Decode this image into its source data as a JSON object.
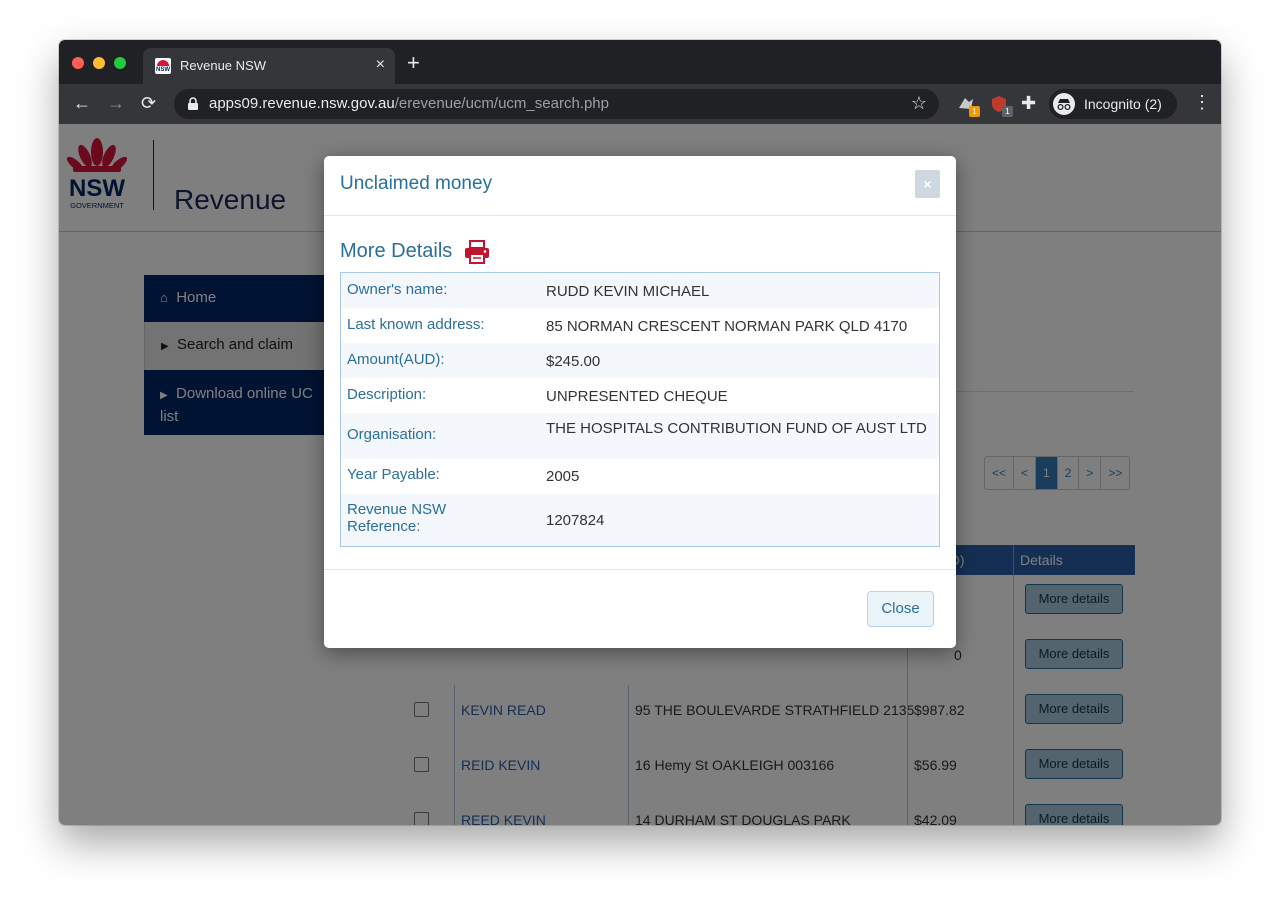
{
  "browser": {
    "tab_title": "Revenue NSW",
    "tab_favicon_text": "NSW",
    "url_host": "apps09.revenue.nsw.gov.au",
    "url_path": "/erevenue/ucm/ucm_search.php",
    "incognito_label": "Incognito (2)",
    "extension_badges": [
      "1",
      "1"
    ]
  },
  "header": {
    "logo_text": "NSW",
    "logo_subtext": "GOVERNMENT",
    "site_title": "Revenue"
  },
  "sidenav": {
    "items": [
      {
        "label": "Home",
        "icon": "home-icon"
      },
      {
        "label": "Search and claim",
        "icon": "caret-right-icon"
      },
      {
        "label": "Download online UC list",
        "icon": "caret-right-icon"
      }
    ]
  },
  "pagination": {
    "items": [
      "<<",
      "<",
      "1",
      "2",
      ">",
      ">>"
    ],
    "active": "1"
  },
  "results": {
    "headers": [
      "",
      "",
      "",
      "nt(AUD)",
      "Details"
    ],
    "button_label": "More details",
    "partial_amount": "0",
    "rows": [
      {
        "name": "KEVIN READ",
        "address": "95 THE BOULEVARDE STRATHFIELD 2135",
        "amount": "$987.82"
      },
      {
        "name": "REID KEVIN",
        "address": "16 Hemy St OAKLEIGH 003166",
        "amount": "$56.99"
      },
      {
        "name": "REED KEVIN",
        "address": "14 DURHAM ST DOUGLAS PARK",
        "amount": "$42.09"
      }
    ]
  },
  "modal": {
    "title": "Unclaimed money",
    "close_x": "×",
    "details_heading": "More Details",
    "fields": [
      {
        "label": "Owner's name:",
        "value": "RUDD KEVIN MICHAEL"
      },
      {
        "label": "Last known address:",
        "value": "85 NORMAN CRESCENT NORMAN PARK QLD 4170"
      },
      {
        "label": "Amount(AUD):",
        "value": "$245.00"
      },
      {
        "label": "Description:",
        "value": "UNPRESENTED CHEQUE"
      },
      {
        "label": "Organisation:",
        "value": "THE HOSPITALS CONTRIBUTION FUND OF AUST LTD"
      },
      {
        "label": "Year Payable:",
        "value": "2005"
      },
      {
        "label": "Revenue NSW Reference:",
        "value": "1207824"
      }
    ],
    "close_label": "Close"
  },
  "colors": {
    "nsw_navy": "#002664",
    "nsw_red": "#d7153a",
    "link_blue": "#2a6f9b",
    "header_blue": "#2a5ea8"
  }
}
